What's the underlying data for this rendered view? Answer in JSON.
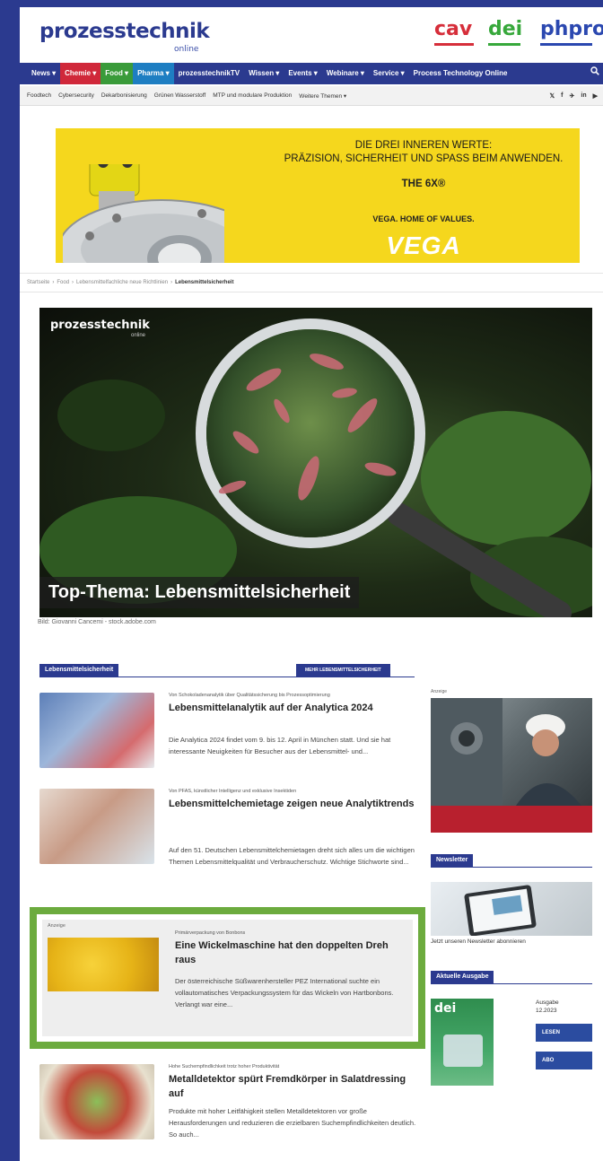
{
  "header": {
    "logo_main": "prozesstechnik",
    "logo_sub": "online",
    "brands": [
      "cav",
      "dei",
      "phpro"
    ]
  },
  "main_nav": {
    "items": [
      "News ▾",
      "Chemie ▾",
      "Food ▾",
      "Pharma ▾",
      "prozesstechnikTV",
      "Wissen ▾",
      "Events ▾",
      "Webinare ▾",
      "Service ▾",
      "Process Technology Online"
    ],
    "search_icon": "search-icon"
  },
  "sub_nav": {
    "items": [
      "Foodtech",
      "Cybersecurity",
      "Dekarbonisierung",
      "Grünen Wasserstoff",
      "MTP und modulare Produktion",
      "Weitere Themen ▾"
    ],
    "social": [
      "𝕏",
      "f",
      "✈",
      "in",
      "▶"
    ]
  },
  "ad_banner": {
    "line1": "DIE DREI INNEREN WERTE:",
    "line2": "PRÄZISION, SICHERHEIT UND SPASS BEIM ANWENDEN.",
    "line3": "THE 6X®",
    "line4": "VEGA. HOME OF VALUES.",
    "brand": "VEGA"
  },
  "breadcrumb": {
    "items": [
      "Startseite",
      "›",
      "Food",
      "›",
      "Lebensmittelfachliche neue Richtlinien",
      "›"
    ],
    "current": "Lebensmittelsicherheit"
  },
  "hero": {
    "logo": "prozesstechnik",
    "logo_sub": "online",
    "title": "Top-Thema: Lebensmittelsicherheit",
    "caption": "Bild: Giovanni Cancemi - stock.adobe.com"
  },
  "section": {
    "tag": "Lebensmittelsicherheit",
    "more_button": "MEHR LEBENSMITTELSICHERHEIT"
  },
  "articles": [
    {
      "kicker": "Von Schokoladenanalytik über Qualitätssicherung bis Prozessoptimierung",
      "title": "Lebensmittelanalytik auf der Analytica 2024",
      "excerpt": "Die Analytica 2024 findet vom 9. bis 12. April in München statt. Und sie hat interessante Neuigkeiten für Besucher aus der Lebensmittel- und..."
    },
    {
      "kicker": "Von PFAS, künstlicher Intelligenz und exklusive Insektiden",
      "title": "Lebensmittelchemietage zeigen neue Analytiktrends",
      "excerpt": "Auf den 51. Deutschen Lebensmittelchemietagen dreht sich alles um die wichtigen Themen Lebensmittelqualität und Verbraucherschutz. Wichtige Stichworte sind..."
    },
    {
      "label": "Anzeige",
      "kicker": "Primärverpackung von Bonbons",
      "title": "Eine Wickelmaschine hat den doppelten Dreh raus",
      "excerpt": "Der österreichische Süßwarenhersteller PEZ International suchte ein vollautomatisches Verpackungssystem für das Wickeln von Hartbonbons. Verlangt war eine..."
    },
    {
      "kicker": "Hohe Suchempfindlichkeit trotz hoher Produktivität",
      "title": "Metalldetektor spürt Fremdkörper in Salatdressing auf",
      "excerpt": "Produkte mit hoher Leitfähigkeit stellen Metalldetektoren vor große Herausforderungen und reduzieren die erzielbaren Suchempfindlichkeiten deutlich. So auch..."
    }
  ],
  "sidebar": {
    "ad_label": "Anzeige",
    "newsletter_tag": "Newsletter",
    "newsletter_text": "Jetzt unseren Newsletter abonnieren",
    "issue_tag": "Aktuelle Ausgabe",
    "cover_title": "dei",
    "issue_label": "Ausgabe",
    "issue_number": "12.2023",
    "read_button": "LESEN",
    "abo_button": "ABO"
  },
  "colors": {
    "navy": "#2b3a8f",
    "red": "#d0283a",
    "green": "#3a9b3a",
    "blue": "#1e7ec2",
    "highlight_green": "#6cab3e",
    "vega_yellow": "#f5d71d"
  }
}
